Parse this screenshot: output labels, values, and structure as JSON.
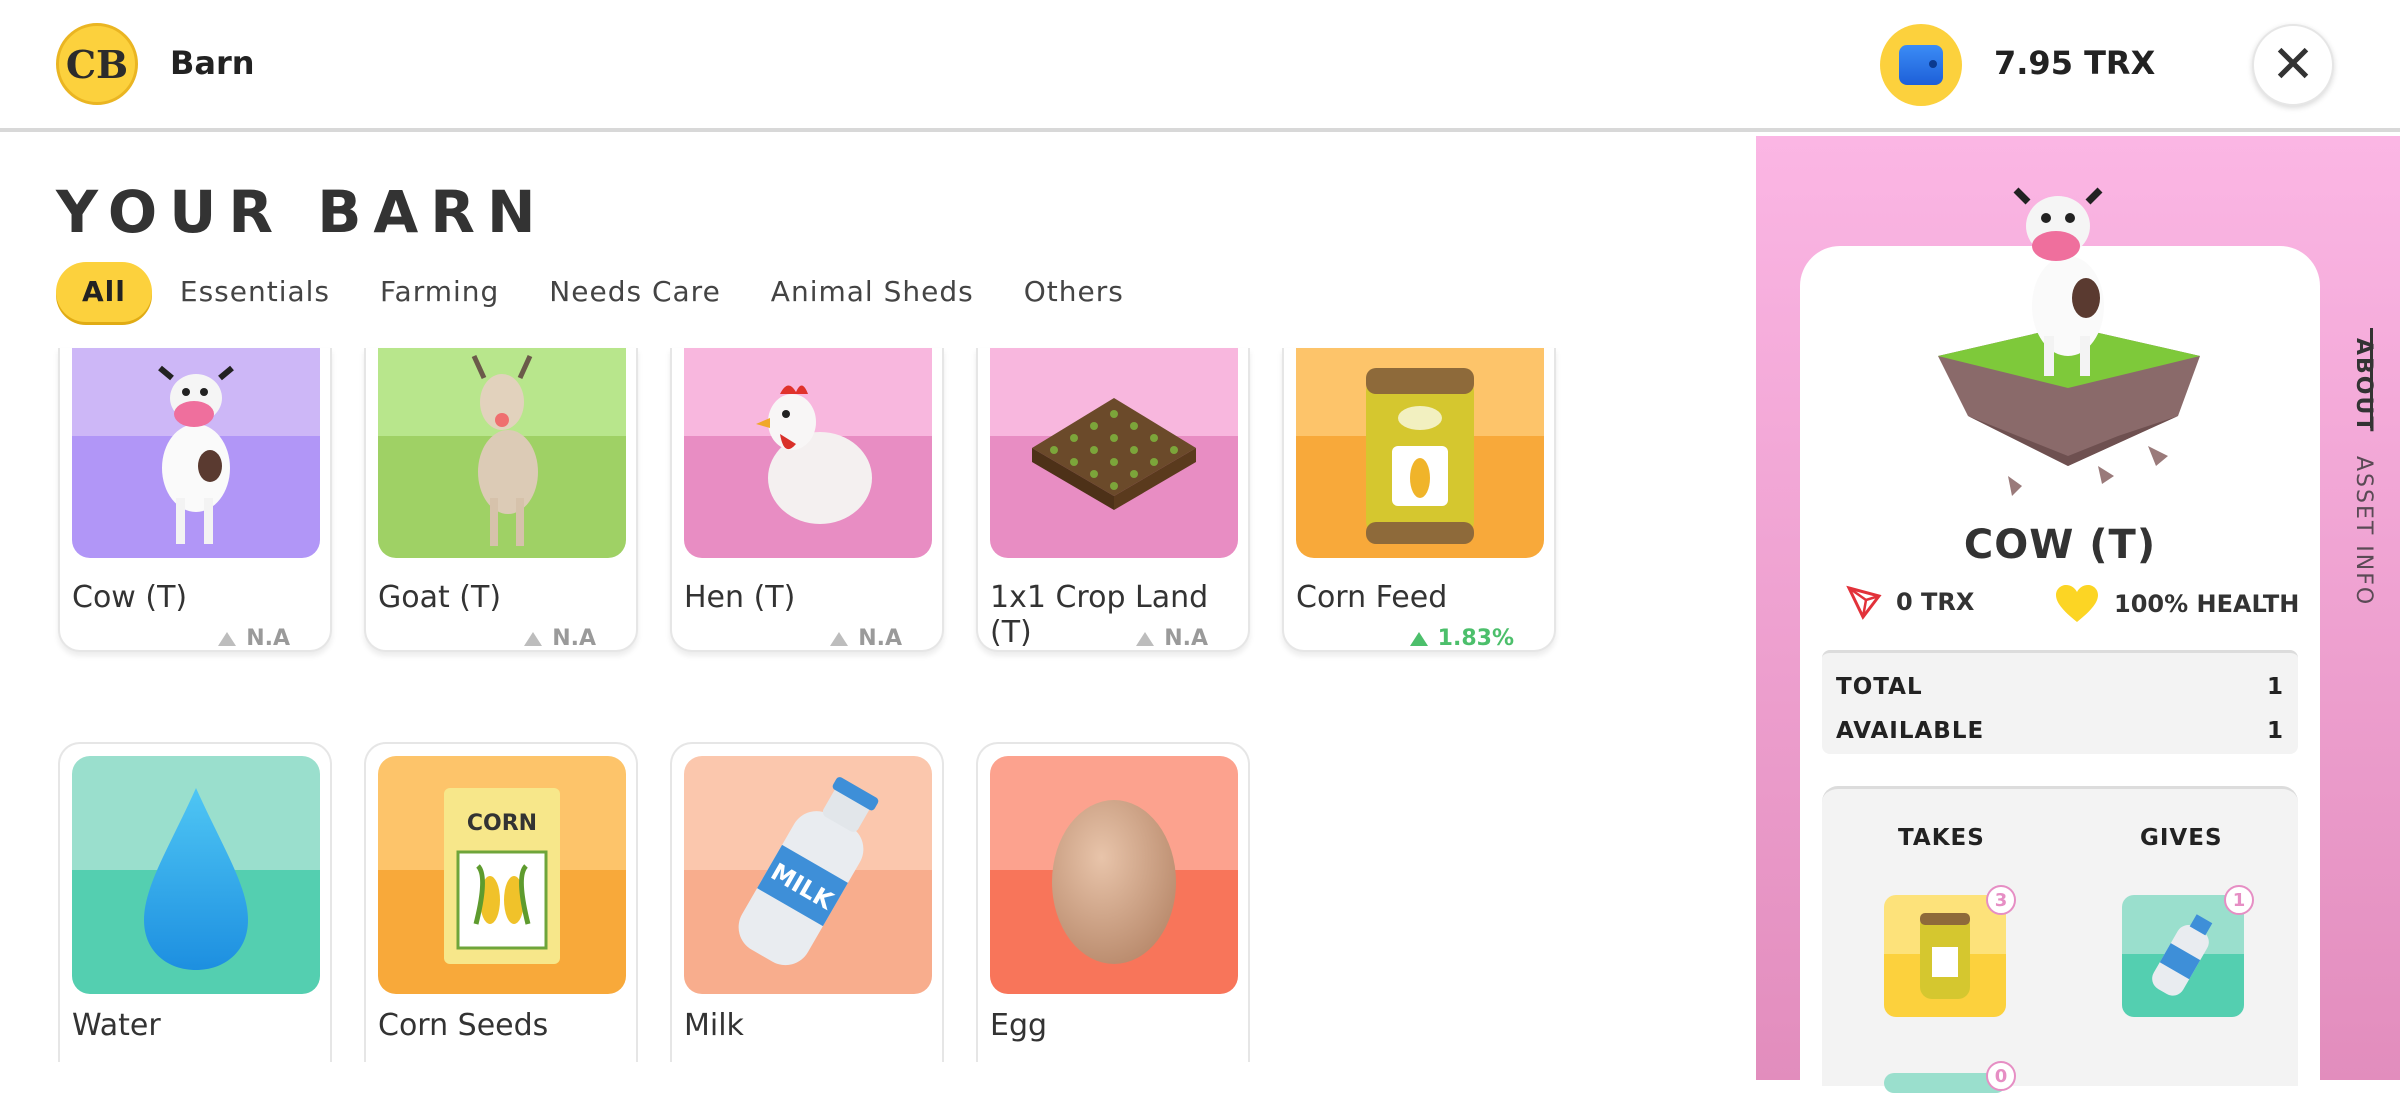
{
  "header": {
    "logo_text": "CB",
    "title": "Barn",
    "balance": "7.95 TRX",
    "close_icon": "close-icon",
    "wallet_icon": "wallet-icon"
  },
  "main": {
    "title": "YOUR BARN",
    "tabs": [
      {
        "label": "All",
        "active": true
      },
      {
        "label": "Essentials",
        "active": false
      },
      {
        "label": "Farming",
        "active": false
      },
      {
        "label": "Needs Care",
        "active": false
      },
      {
        "label": "Animal Sheds",
        "active": false
      },
      {
        "label": "Others",
        "active": false
      }
    ],
    "items": [
      {
        "name": "Cow (T)",
        "stat": "N.A",
        "icon": "cow-icon",
        "colors": [
          "#cdb7f7",
          "#b196f7"
        ]
      },
      {
        "name": "Goat (T)",
        "stat": "N.A",
        "icon": "goat-icon",
        "colors": [
          "#b8e68c",
          "#9fd165"
        ]
      },
      {
        "name": "Hen (T)",
        "stat": "N.A",
        "icon": "hen-icon",
        "colors": [
          "#f8b7de",
          "#e88dc3"
        ]
      },
      {
        "name": "1x1 Crop Land (T)",
        "stat": "N.A",
        "icon": "crop-land-icon",
        "colors": [
          "#f8b7de",
          "#e88dc3"
        ]
      },
      {
        "name": "Corn Feed",
        "stat": "1.83%",
        "icon": "corn-feed-icon",
        "colors": [
          "#fdc46a",
          "#f8a93a"
        ]
      },
      {
        "name": "Water",
        "icon": "water-drop-icon",
        "colors": [
          "#9adfcd",
          "#54cfb0"
        ]
      },
      {
        "name": "Corn Seeds",
        "icon": "corn-seeds-icon",
        "colors": [
          "#fdc46a",
          "#f8a93a"
        ]
      },
      {
        "name": "Milk",
        "icon": "milk-bottle-icon",
        "colors": [
          "#fbc7ad",
          "#f8ad8d"
        ]
      },
      {
        "name": "Egg",
        "icon": "egg-icon",
        "colors": [
          "#fca28e",
          "#f8755a"
        ]
      }
    ]
  },
  "detail": {
    "name": "COW (T)",
    "price": "0 TRX",
    "health": "100% HEALTH",
    "total_label": "TOTAL",
    "total_value": "1",
    "available_label": "AVAILABLE",
    "available_value": "1",
    "takes_label": "TAKES",
    "gives_label": "GIVES",
    "takes": [
      {
        "icon": "corn-feed-icon",
        "count": "3"
      },
      {
        "icon": "water-drop-icon",
        "count": "0"
      }
    ],
    "gives": [
      {
        "icon": "milk-bottle-icon",
        "count": "1"
      }
    ],
    "side_tabs": [
      "ABOUT",
      "ASSET INFO"
    ]
  }
}
